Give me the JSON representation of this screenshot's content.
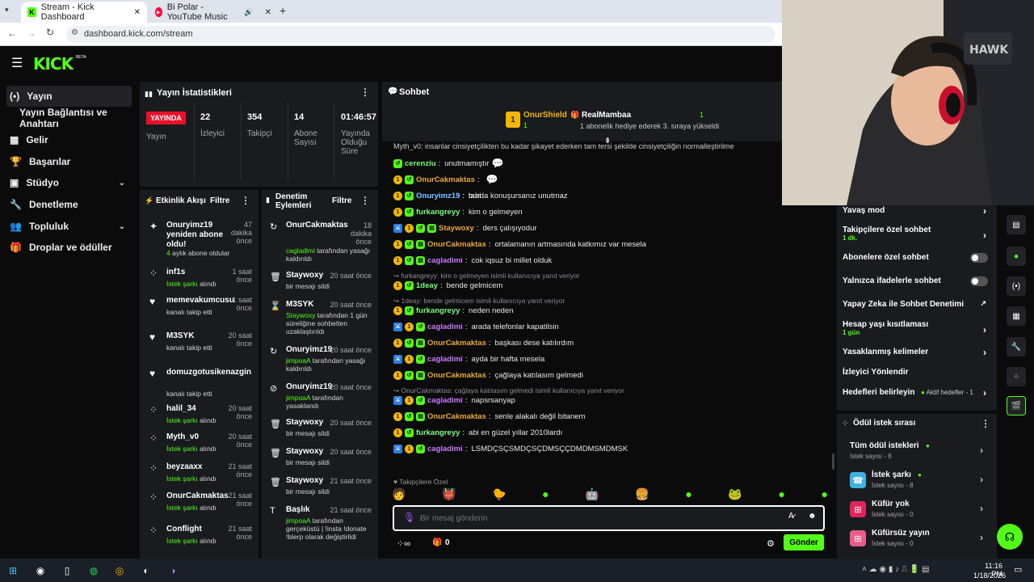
{
  "browser": {
    "tabs": [
      {
        "label": "Stream - Kick Dashboard"
      },
      {
        "label": "Bi Polar - YouTube Music"
      }
    ],
    "url": "dashboard.kick.com/stream"
  },
  "kick": {
    "logo": "KICK",
    "logo_badge": "BETA"
  },
  "sidebar": {
    "items": [
      {
        "label": "Yayın",
        "icon": "broadcast-icon"
      },
      {
        "label": "Yayın Bağlantısı ve Anahtarı"
      },
      {
        "label": "Gelir",
        "icon": "chart-icon"
      },
      {
        "label": "Başarılar",
        "icon": "trophy-icon"
      },
      {
        "label": "Stüdyo",
        "icon": "studio-icon"
      },
      {
        "label": "Denetleme",
        "icon": "wrench-icon"
      },
      {
        "label": "Topluluk",
        "icon": "community-icon"
      },
      {
        "label": "Droplar ve ödüller",
        "icon": "gift-icon"
      }
    ]
  },
  "stats": {
    "title": "Yayın İstatistikleri",
    "live_badge": "YAYINDA",
    "live_label": "Yayın",
    "viewers": "22",
    "viewers_label": "İzleyici",
    "followers": "354",
    "followers_label": "Takipçi",
    "subs": "14",
    "subs_label": "Abone Sayısı",
    "uptime": "01:46:57",
    "uptime_label": "Yayında Olduğu Süre"
  },
  "activity": {
    "title": "Etkinlik Akışı",
    "filter": "Filtre",
    "items": [
      {
        "name": "Onuryimz19 yeniden abone oldu!",
        "time": "47 dakika önce",
        "sub_green": "4",
        "sub": " aylık abone oldular"
      },
      {
        "name": "inf1s",
        "time": "1 saat önce",
        "sub_green": "İstek şarkı",
        "sub": " alındı"
      },
      {
        "name": "memevakumcusu",
        "time": "1 saat önce",
        "sub": "kanalı takip etti"
      },
      {
        "name": "M3SYK",
        "time": "20 saat önce",
        "sub": "kanalı takip etti"
      },
      {
        "name": "domuzgotusikenazgin",
        "time": "",
        "sub": "kanalı takip etti"
      },
      {
        "name": "halil_34",
        "time": "20 saat önce",
        "sub_green": "İstek şarkı",
        "sub": " alındı"
      },
      {
        "name": "Myth_v0",
        "time": "20 saat önce",
        "sub_green": "İstek şarkı",
        "sub": " alındı"
      },
      {
        "name": "beyzaaxx",
        "time": "21 saat önce",
        "sub_green": "İstek şarkı",
        "sub": " alındı"
      },
      {
        "name": "OnurCakmaktas",
        "time": "21 saat önce",
        "sub_green": "İstek şarkı",
        "sub": " alındı"
      },
      {
        "name": "Conflight",
        "time": "21 saat önce",
        "sub_green": "İstek şarkı",
        "sub": " alındı"
      }
    ]
  },
  "moderation": {
    "title": "Denetim Eylemleri",
    "filter": "Filtre",
    "items": [
      {
        "name": "OnurCakmaktas",
        "time": "18 dakika önce",
        "sub_green": "cagladimi",
        "sub": " tarafından yasağı kaldırıldı"
      },
      {
        "name": "Staywoxy",
        "time": "20 saat önce",
        "sub": "bir mesajı sildi"
      },
      {
        "name": "M3SYK",
        "time": "20 saat önce",
        "sub_green": "Staywoxy",
        "sub": " tarafından 1 gün süreliğine sohbetten uzaklaştırıldı"
      },
      {
        "name": "Onuryimz19",
        "time": "20 saat önce",
        "sub_green": "jimpoaA",
        "sub": " tarafından yasağı kaldırıldı"
      },
      {
        "name": "Onuryimz19",
        "time": "20 saat önce",
        "sub_green": "jimpoaA",
        "sub": " tarafından yasaklandı"
      },
      {
        "name": "Staywoxy",
        "time": "20 saat önce",
        "sub": "bir mesajı sildi"
      },
      {
        "name": "Staywoxy",
        "time": "20 saat önce",
        "sub": "bir mesajı sildi"
      },
      {
        "name": "Staywoxy",
        "time": "21 saat önce",
        "sub": "bir mesajı sildi"
      },
      {
        "name": "Başlık",
        "time": "21 saat önce",
        "sub_green": "jimpoaA",
        "sub": " tarafından gerçeküstü | !insta !donate !blerp olarak değiştirildi"
      }
    ]
  },
  "chat": {
    "title": "Sohbet",
    "pinned_user": "OnurShield",
    "pinned_count": "1",
    "gift_user": "RealMambaa",
    "gift_count": "1",
    "gift_text": "1 abonelik hediye ederek 3. sıraya yükseldi",
    "truncated": "Myth_v0: insanlar cinsiyetçilikten bu kadar şikayet ederken tam tersi şekilde cinsiyetçiliğin normalleştirilme",
    "messages": [
      {
        "user": "cerenziu",
        "text": "unutmamıştır",
        "color": "#7cfc7c",
        "badges": "s"
      },
      {
        "user": "OnurCakmaktas",
        "text": "",
        "color": "#e9a93a",
        "badges": "os"
      },
      {
        "user": "Onuryimz19",
        "text": "burda konuşursanız unutmaz",
        "color": "#6fb7ff",
        "badges": "os"
      },
      {
        "user": "Onuryimz19",
        "text": "tabi",
        "color": "#6fb7ff",
        "badges": "os"
      },
      {
        "user": "furkangreyy",
        "text": "kim o gelmeyen",
        "color": "#7cfc7c",
        "badges": "os"
      },
      {
        "user": "Staywoxy",
        "text": "ders çalışıyodur",
        "color": "#e9a93a",
        "badges": "mosg"
      },
      {
        "user": "OnurCakmaktas",
        "text": "ortalamanın artmasında katkımız var mesela",
        "color": "#e9a93a",
        "badges": "osg"
      },
      {
        "user": "cagladimi",
        "text": "cok iqsuz bi millet olduk",
        "color": "#c77dff",
        "badges": "osg"
      },
      {
        "reply": "furkangreyy: kim o gelmeyen isimli kullanıcıya yanıt veriyor"
      },
      {
        "user": "1deay",
        "text": "bende gelmicem",
        "color": "#7cfc7c",
        "badges": "os"
      },
      {
        "reply": "1deay: bende gelmicem isimli kullanıcıya yanıt veriyor"
      },
      {
        "user": "furkangreyy",
        "text": "neden neden",
        "color": "#7cfc7c",
        "badges": "os"
      },
      {
        "user": "cagladimi",
        "text": "arada telefonlar kapatilsin",
        "color": "#c77dff",
        "badges": "mos"
      },
      {
        "user": "OnurCakmaktas",
        "text": "başkası dese katılırdım",
        "color": "#e9a93a",
        "badges": "osg"
      },
      {
        "user": "cagladimi",
        "text": "ayda bir hafta mesela",
        "color": "#c77dff",
        "badges": "mos"
      },
      {
        "user": "OnurCakmaktas",
        "text": "çağlaya katılasım gelmedi",
        "color": "#e9a93a",
        "badges": "osg"
      },
      {
        "reply": "OnurCakmaktas: çağlaya katılasım gelmedi isimli kullanıcıya yanıt veriyor"
      },
      {
        "user": "cagladimi",
        "text": "napsrsanyap",
        "color": "#c77dff",
        "badges": "mos"
      },
      {
        "user": "OnurCakmaktas",
        "text": "senle alakalı değil bitanem",
        "color": "#e9a93a",
        "badges": "osg"
      },
      {
        "user": "furkangreyy",
        "text": "abi en güzel yıllar 2010lardı",
        "color": "#7cfc7c",
        "badges": "os"
      },
      {
        "user": "cagladimi",
        "text": "LSMDÇSÇSMDÇSÇDMSÇÇDMDMSMDMSK",
        "color": "#c77dff",
        "badges": "mos"
      }
    ],
    "followers_only": "Takipçilere Özel",
    "placeholder": "Bir mesaj gönderin",
    "points": "0",
    "send": "Gönder"
  },
  "chat_settings": [
    {
      "label": "Yavaş mod",
      "type": "arrow"
    },
    {
      "label": "Takipçilere özel sohbet",
      "sub": "1 dk.",
      "type": "arrow"
    },
    {
      "label": "Abonelere özel sohbet",
      "type": "toggle"
    },
    {
      "label": "Yalnızca ifadelerle sohbet",
      "type": "toggle"
    },
    {
      "label": "Yapay Zeka ile Sohbet Denetimi",
      "type": "ext"
    },
    {
      "label": "Hesap yaşı kısıtlaması",
      "sub": "1 gün",
      "type": "arrow"
    },
    {
      "label": "Yasaklanmış kelimeler",
      "type": "arrow"
    },
    {
      "label": "İzleyici Yönlendir",
      "type": "none"
    },
    {
      "label": "Hedefleri belirleyin",
      "extra": "Aktif hedefler - 1",
      "type": "arrow"
    }
  ],
  "rewards": {
    "title": "Ödül istek sırası",
    "all": "Tüm ödül istekleri",
    "all_sub": "İstek sayısı - 8",
    "items": [
      {
        "label": "İstek şarkı",
        "sub": "İstek sayısı - 8",
        "color": "#3fb2e0",
        "dot": true
      },
      {
        "label": "Küfür yok",
        "sub": "İstek sayısı - 0",
        "color": "#e0245e",
        "dot": false
      },
      {
        "label": "Küfürsüz yayın",
        "sub": "İstek sayısı - 0",
        "color": "#e85d8a",
        "dot": false
      }
    ]
  },
  "taskbar": {
    "time": "11:16 PM",
    "date": "1/18/2026"
  }
}
